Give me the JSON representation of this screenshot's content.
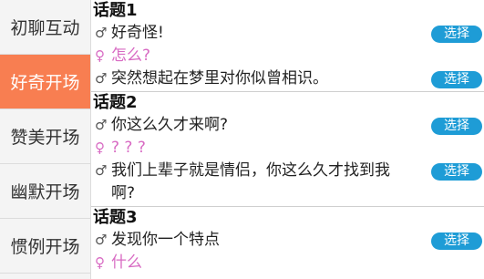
{
  "sidebar": {
    "items": [
      {
        "label": "初聊互动",
        "active": false
      },
      {
        "label": "好奇开场",
        "active": true
      },
      {
        "label": "赞美开场",
        "active": false
      },
      {
        "label": "幽默开场",
        "active": false
      },
      {
        "label": "惯例开场",
        "active": false
      }
    ]
  },
  "main": {
    "topics": [
      {
        "title": "话题1",
        "lines": [
          {
            "symbol": "♂",
            "text": "好奇怪!",
            "gender": "male",
            "button": "选择"
          },
          {
            "symbol": "♀",
            "text": "怎么?",
            "gender": "female"
          },
          {
            "symbol": "♂",
            "text": "突然想起在梦里对你似曾相识。",
            "gender": "male",
            "button": "选择"
          }
        ]
      },
      {
        "title": "话题2",
        "lines": [
          {
            "symbol": "♂",
            "text": "你这么久才来啊?",
            "gender": "male",
            "button": "选择"
          },
          {
            "symbol": "♀",
            "text": "? ? ?",
            "gender": "female"
          },
          {
            "symbol": "♂",
            "text": "我们上辈子就是情侣，你这么久才找到我啊?",
            "gender": "male",
            "button": "选择"
          }
        ]
      },
      {
        "title": "话题3",
        "lines": [
          {
            "symbol": "♂",
            "text": "发现你一个特点",
            "gender": "male",
            "button": "选择"
          },
          {
            "symbol": "♀",
            "text": "什么",
            "gender": "female"
          }
        ]
      }
    ]
  },
  "colors": {
    "accent": "#f87e51",
    "button": "#1e9cd6",
    "female_text": "#d86bc3"
  }
}
